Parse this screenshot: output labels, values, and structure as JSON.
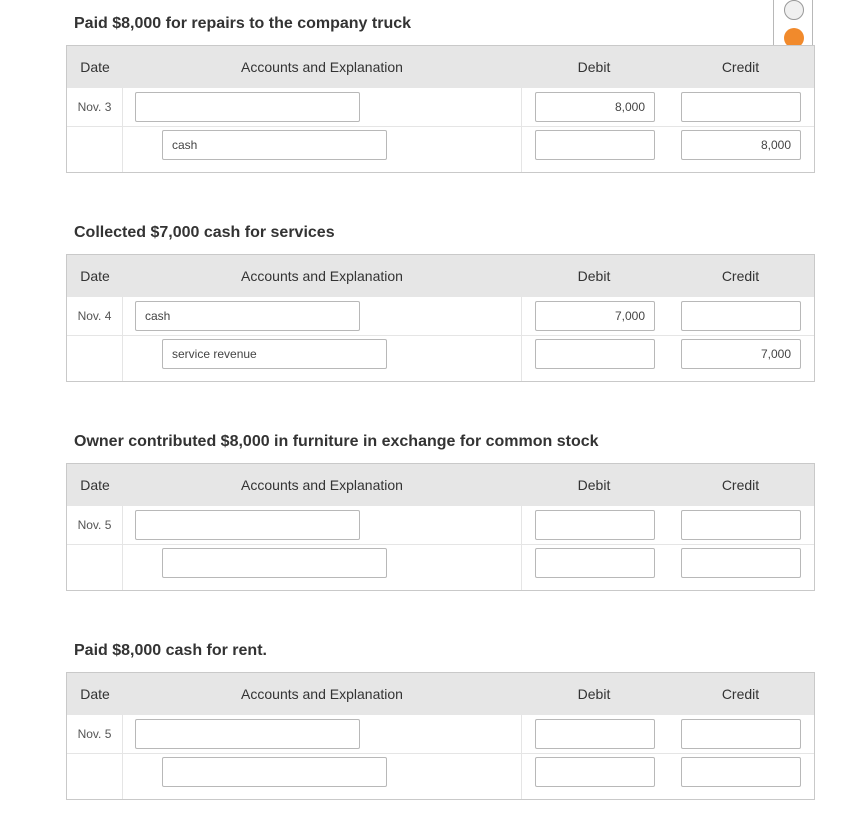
{
  "headers": {
    "date": "Date",
    "accounts": "Accounts and Explanation",
    "debit": "Debit",
    "credit": "Credit"
  },
  "toggle_icons": [
    "grey-circle-icon",
    "orange-circle-icon"
  ],
  "colors": {
    "accent": "#f18a2c",
    "header_bg": "#e6e6e6"
  },
  "entries": [
    {
      "title": "Paid $8,000 for repairs to the company truck",
      "date": "Nov. 3",
      "row1": {
        "account": "",
        "debit": "8,000",
        "credit": ""
      },
      "row2": {
        "account": "cash",
        "debit": "",
        "credit": "8,000"
      }
    },
    {
      "title": "Collected $7,000 cash for services",
      "date": "Nov. 4",
      "row1": {
        "account": "cash",
        "debit": "7,000",
        "credit": ""
      },
      "row2": {
        "account": "service revenue",
        "debit": "",
        "credit": "7,000"
      }
    },
    {
      "title": "Owner contributed $8,000 in furniture in exchange for common stock",
      "date": "Nov. 5",
      "row1": {
        "account": "",
        "debit": "",
        "credit": ""
      },
      "row2": {
        "account": "",
        "debit": "",
        "credit": ""
      }
    },
    {
      "title": "Paid $8,000 cash for rent.",
      "date": "Nov. 5",
      "row1": {
        "account": "",
        "debit": "",
        "credit": ""
      },
      "row2": {
        "account": "",
        "debit": "",
        "credit": ""
      }
    }
  ]
}
